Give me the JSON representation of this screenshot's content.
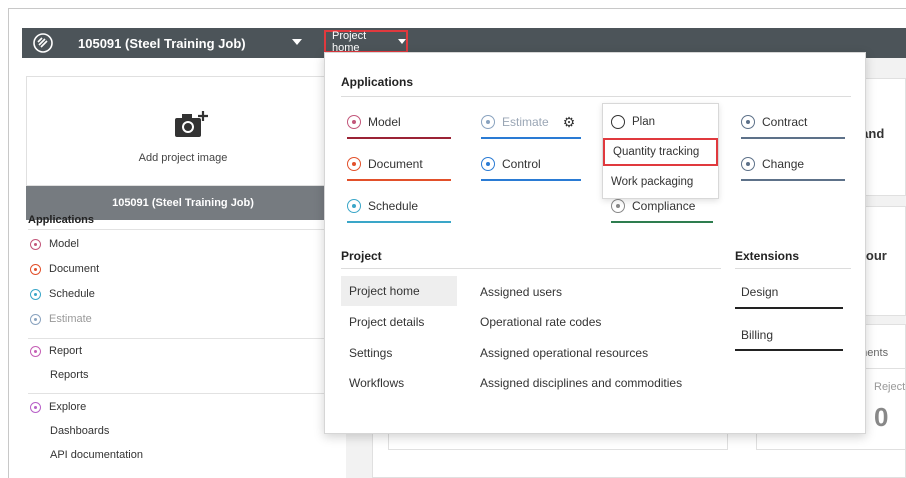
{
  "header": {
    "job_name": "105091 (Steel Training Job)",
    "project_home_label": "Project home"
  },
  "left_panel": {
    "add_image_label": "Add project image",
    "job_title": "105091 (Steel Training Job)",
    "applications_heading": "Applications",
    "apps": [
      {
        "label": "Model",
        "color": "#c2567a"
      },
      {
        "label": "Document",
        "color": "#e2502a"
      },
      {
        "label": "Schedule",
        "color": "#3aa6c8"
      },
      {
        "label": "Estimate",
        "color": "#8aa3bf"
      }
    ],
    "report": {
      "label": "Report",
      "color": "#c55fb5"
    },
    "reports_label": "Reports",
    "explore": {
      "label": "Explore",
      "color": "#b860c8"
    },
    "dashboards_label": "Dashboards",
    "api_label": "API documentation"
  },
  "background": {
    "partial_1": "ts and",
    "partial_2": "r your",
    "partial_3": "uments",
    "partial_4": "Reject",
    "partial_5": "0"
  },
  "menu": {
    "applications_heading": "Applications",
    "apps": {
      "model": {
        "label": "Model",
        "color": "#9b2335"
      },
      "estimate": {
        "label": "Estimate",
        "color": "#2a7bd4"
      },
      "plan": {
        "label": "Plan",
        "color": "#333333"
      },
      "contract": {
        "label": "Contract",
        "color": "#5d7189"
      },
      "document": {
        "label": "Document",
        "color": "#e2502a"
      },
      "control": {
        "label": "Control",
        "color": "#2a7bd4"
      },
      "change": {
        "label": "Change",
        "color": "#5d7189"
      },
      "schedule": {
        "label": "Schedule",
        "color": "#3aa6c8"
      },
      "compliance": {
        "label": "Compliance",
        "color": "#2e7d4f"
      }
    },
    "plan_submenu": {
      "quantity_tracking": "Quantity tracking",
      "work_packaging": "Work packaging"
    },
    "project_heading": "Project",
    "project_links_col1": [
      "Project home",
      "Project details",
      "Settings",
      "Workflows"
    ],
    "project_links_col2": [
      "Assigned users",
      "Operational rate codes",
      "Assigned operational resources",
      "Assigned disciplines and commodities"
    ],
    "extensions_heading": "Extensions",
    "extensions": [
      "Design",
      "Billing"
    ]
  }
}
